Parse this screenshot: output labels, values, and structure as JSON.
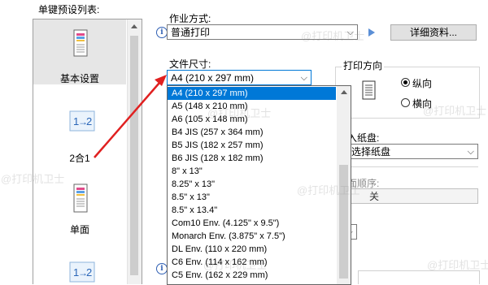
{
  "presets": {
    "title": "单键预设列表:",
    "items": [
      {
        "label": "基本设置",
        "icon": "document-page-icon"
      },
      {
        "label": "2合1",
        "icon": "two-in-one-icon"
      },
      {
        "label": "单面",
        "icon": "single-page-icon"
      },
      {
        "label": "",
        "icon": "one-two-icon"
      }
    ]
  },
  "job": {
    "label": "作业方式:",
    "value": "普通打印",
    "details_button": "详细资料..."
  },
  "paper_size": {
    "label": "文件尺寸:",
    "value": "A4 (210 x 297 mm)",
    "options": [
      "A4 (210 x 297 mm)",
      "A5 (148 x 210 mm)",
      "A6 (105 x 148 mm)",
      "B4 JIS (257 x 364 mm)",
      "B5 JIS (182 x 257 mm)",
      "B6 JIS (128 x 182 mm)",
      "8\" x 13\"",
      "8.25\" x 13\"",
      "8.5\" x 13\"",
      "8.5\" x 13.4\"",
      "Com10 Env. (4.125\" x 9.5\")",
      "Monarch Env. (3.875\" x 7.5\")",
      "DL Env. (110 x 220 mm)",
      "C6 Env. (114 x 162 mm)",
      "C5 Env. (162 x 229 mm)"
    ]
  },
  "orientation": {
    "label": "打印方向",
    "portrait": "纵向",
    "landscape": "横向",
    "selected": "纵向"
  },
  "paper_source": {
    "label_partial": "入纸盘:",
    "value_partial": "动选择纸盘"
  },
  "page_order": {
    "label_partial": "面顺序:",
    "value": "关"
  },
  "watermark": "@打印机卫士",
  "colors": {
    "highlight": "#0078d7",
    "arrow": "#e02020",
    "info": "#2f5fb3"
  }
}
